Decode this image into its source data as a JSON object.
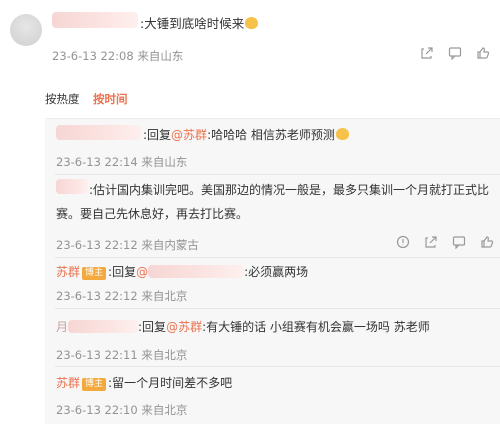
{
  "top_comment": {
    "text": ":大锤到底啥时候来",
    "meta": "23-6-13 22:08 来自山东"
  },
  "tabs": {
    "hot": "按热度",
    "time": "按时间"
  },
  "replies": [
    {
      "reply_prefix": ":回复",
      "mention": "@苏群",
      "text": ":哈哈哈 相信苏老师预测",
      "meta": "23-6-13 22:14 来自山东"
    },
    {
      "text_line1": ":估计国内集训完吧。美国那边的情况一般是，最多只集训一个月就打正式比",
      "text_line2": "赛。要自己先休息好，再去打比赛。",
      "meta": "23-6-13 22:12 来自内蒙古"
    },
    {
      "name": "苏群",
      "badge": "博主",
      "reply_prefix": ":回复",
      "mention": "@",
      "text": ":必须赢两场",
      "meta": "23-6-13 22:12 来自北京"
    },
    {
      "prefix_char": "月",
      "reply_prefix": ":回复",
      "mention": "@苏群",
      "text": ":有大锤的话 小组赛有机会赢一场吗 苏老师",
      "meta": "23-6-13 22:11 来自北京"
    },
    {
      "name": "苏群",
      "badge": "博主",
      "text": ":留一个月时间差不多吧",
      "meta": "23-6-13 22:10 来自北京"
    }
  ],
  "icons": [
    "share-icon",
    "comment-icon",
    "like-icon",
    "report-icon"
  ]
}
